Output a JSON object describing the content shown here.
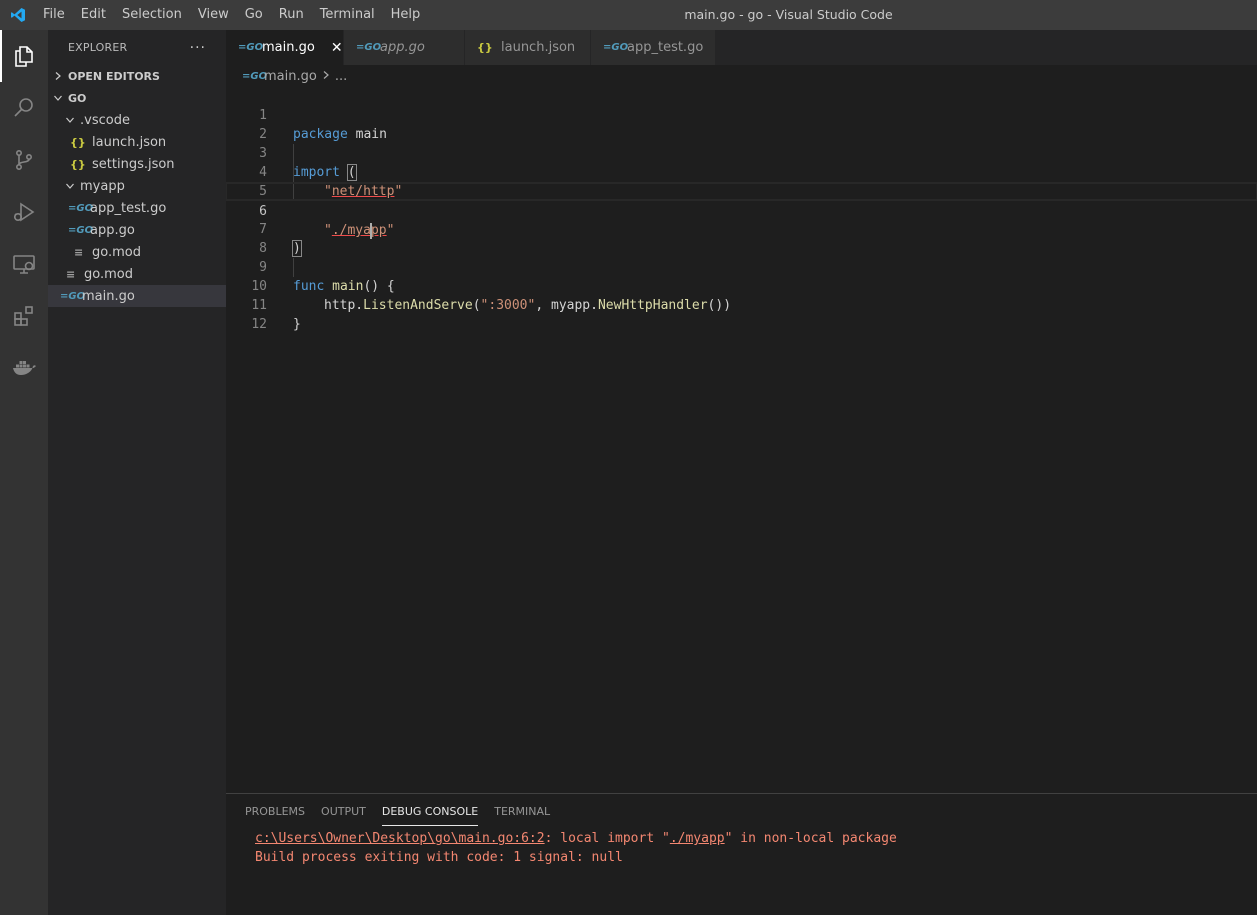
{
  "titlebar": {
    "menus": [
      "File",
      "Edit",
      "Selection",
      "View",
      "Go",
      "Run",
      "Terminal",
      "Help"
    ],
    "window_title": "main.go - go - Visual Studio Code"
  },
  "activitybar": {
    "items": [
      "explorer-icon",
      "search-icon",
      "source-control-icon",
      "run-debug-icon",
      "remote-explorer-icon",
      "extensions-icon",
      "docker-icon"
    ]
  },
  "sidebar": {
    "title": "EXPLORER",
    "more": "···",
    "open_editors": "OPEN EDITORS",
    "folder": "GO",
    "tree": {
      "vscode": ".vscode",
      "launch_json": "launch.json",
      "settings_json": "settings.json",
      "myapp": "myapp",
      "app_test_go": "app_test.go",
      "app_go": "app.go",
      "myapp_go_mod": "go.mod",
      "root_go_mod": "go.mod",
      "main_go": "main.go"
    }
  },
  "tabs": [
    {
      "label": "main.go",
      "close": "✕"
    },
    {
      "label": "app.go"
    },
    {
      "label": "launch.json"
    },
    {
      "label": "app_test.go"
    }
  ],
  "breadcrumb": {
    "file": "main.go",
    "rest": "..."
  },
  "editor": {
    "line_numbers": [
      "1",
      "2",
      "3",
      "4",
      "5",
      "6",
      "7",
      "8",
      "9",
      "10",
      "11",
      "12"
    ],
    "tokens": {
      "package": "package",
      "main_pkg": " main",
      "import": "import",
      "open_paren": "(",
      "net_http_q1": "\"",
      "net_http": "net/http",
      "net_http_q2": "\"",
      "myapp_q1": "\"",
      "myapp_a": "./mya",
      "myapp_b": "pp",
      "myapp_q2": "\"",
      "close_paren": ")",
      "func": "func",
      "main_fn": "main",
      "main_sig": "() {",
      "http": "http.",
      "listen": "ListenAndServe",
      "paren_open": "(",
      "port": "\":3000\"",
      "comma": ", myapp.",
      "handler": "NewHttpHandler",
      "paren_close": "())",
      "close_brace": "}"
    }
  },
  "panel": {
    "tabs": [
      "PROBLEMS",
      "OUTPUT",
      "DEBUG CONSOLE",
      "TERMINAL"
    ],
    "console": {
      "path": "c:\\Users\\Owner\\Desktop\\go\\main.go:6:2",
      "msg_a": ": local import \"",
      "import_path": "./myapp",
      "msg_b": "\" in non-local package",
      "line2": "Build process exiting with code: 1 signal: null"
    }
  }
}
